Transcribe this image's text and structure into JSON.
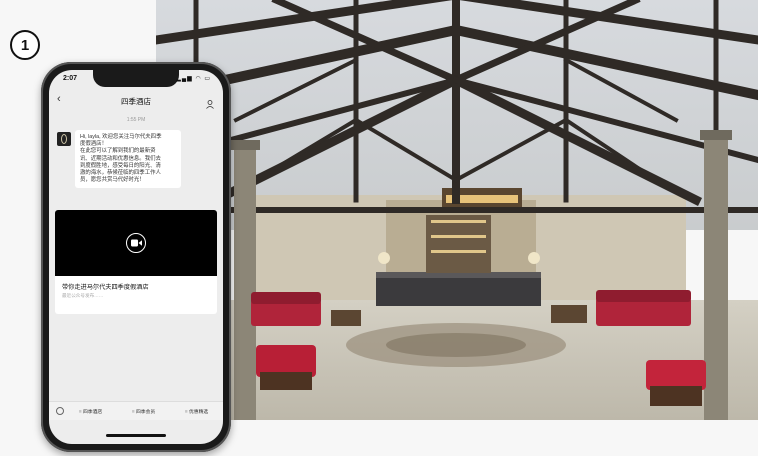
{
  "step": {
    "number": "1"
  },
  "phone": {
    "status_time": "2:07",
    "status_icons": "▂▄▆ ◠ ▭",
    "nav_title": "四季酒店",
    "chat_time": "1:55 PM",
    "message_lines": [
      "Hi, layla, 欢迎您关注马尔代夫四季",
      "度假酒店！",
      "在此您可以了解到我们的最新资",
      "讯、近期活动和优惠信息。我们去",
      "到度假胜地，感受每日的阳光、清",
      "澈的海水，恭候莅临的四季工作人",
      "员，愿您共赏马代好时光！"
    ],
    "video_title": "带你走进马尔代夫四季度假酒店",
    "video_sub": "最近公众号发布……",
    "menu": [
      "四季酒店",
      "四季会员",
      "优惠精选"
    ]
  }
}
